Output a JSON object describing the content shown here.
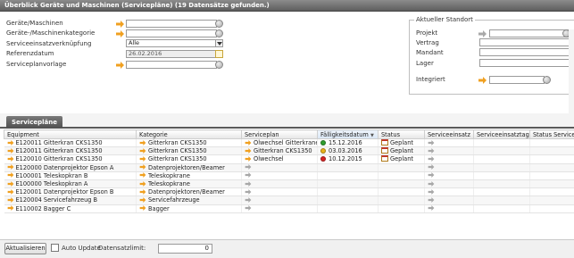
{
  "window": {
    "title": "Überblick Geräte und Maschinen (Servicepläne) (19 Datensätze gefunden.)"
  },
  "filters": {
    "geraete_label": "Geräte/Maschinen",
    "kategorie_label": "Geräte-/Maschinenkategorie",
    "verknuepfung_label": "Serviceeinsatzverknüpfung",
    "verknuepfung_value": "Alle",
    "referenzdatum_label": "Referenzdatum",
    "referenzdatum_value": "26.02.2016",
    "vorlage_label": "Serviceplanvorlage"
  },
  "standort": {
    "legend": "Aktueller Standort",
    "projekt_label": "Projekt",
    "vertrag_label": "Vertrag",
    "mandant_label": "Mandant",
    "lager_label": "Lager",
    "integriert_label": "Integriert"
  },
  "tab": {
    "label": "Servicepläne"
  },
  "grid": {
    "columns": [
      "Equipment",
      "Kategorie",
      "Serviceplan",
      "Fälligkeitsdatum",
      "Status",
      "Serviceeinsatz",
      "Serviceeinsatztag",
      "Status Service"
    ],
    "sort_indicator": "▼",
    "rows": [
      {
        "equipment": "E120011 Gitterkran CKS1350",
        "kategorie": "Gitterkran CKS1350",
        "serviceplan": "Ölwechsel Gitterkrane",
        "datum": "15.12.2016",
        "dot": "#2e9e2e",
        "status": "Geplant"
      },
      {
        "equipment": "E120011 Gitterkran CKS1350",
        "kategorie": "Gitterkran CKS1350",
        "serviceplan": "Gitterkran CKS1350",
        "datum": "03.03.2016",
        "dot": "#e8b31c",
        "status": "Geplant"
      },
      {
        "equipment": "E120010 Gitterkran CKS1350",
        "kategorie": "Gitterkran CKS1350",
        "serviceplan": "Ölwechsel",
        "datum": "10.12.2015",
        "dot": "#d62424",
        "status": "Geplant"
      },
      {
        "equipment": "E120000 Datenprojektor Epson A",
        "kategorie": "Datenprojektoren/Beamer",
        "serviceplan": "",
        "datum": "",
        "dot": "",
        "status": ""
      },
      {
        "equipment": "E100001 Teleskopkran B",
        "kategorie": "Teleskopkrane",
        "serviceplan": "",
        "datum": "",
        "dot": "",
        "status": ""
      },
      {
        "equipment": "E100000 Teleskopkran A",
        "kategorie": "Teleskopkrane",
        "serviceplan": "",
        "datum": "",
        "dot": "",
        "status": ""
      },
      {
        "equipment": "E120001 Datenprojektor Epson B",
        "kategorie": "Datenprojektoren/Beamer",
        "serviceplan": "",
        "datum": "",
        "dot": "",
        "status": ""
      },
      {
        "equipment": "E120004 Servicefahrzeug B",
        "kategorie": "Servicefahrzeuge",
        "serviceplan": "",
        "datum": "",
        "dot": "",
        "status": ""
      },
      {
        "equipment": "E110002 Bagger C",
        "kategorie": "Bagger",
        "serviceplan": "",
        "datum": "",
        "dot": "",
        "status": ""
      }
    ]
  },
  "bottom": {
    "refresh_label": "Aktualisieren",
    "auto_update_label": "Auto Update",
    "limit_label": "Datensatzlimit:",
    "limit_value": "0"
  },
  "colors": {
    "arrow_orange": "#f0a020",
    "arrow_grey": "#a8a8a8",
    "header_dark": "#5e5e5e"
  }
}
